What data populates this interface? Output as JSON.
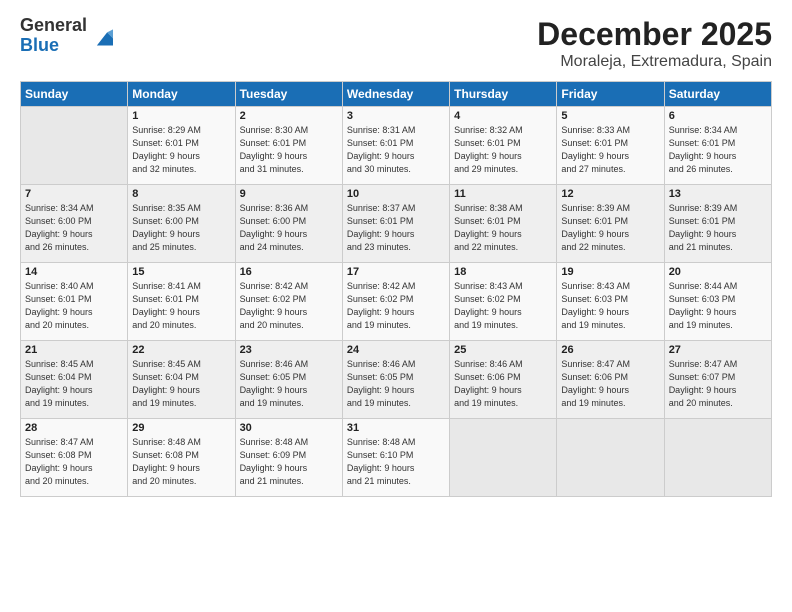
{
  "logo": {
    "general": "General",
    "blue": "Blue"
  },
  "title": "December 2025",
  "location": "Moraleja, Extremadura, Spain",
  "weekdays": [
    "Sunday",
    "Monday",
    "Tuesday",
    "Wednesday",
    "Thursday",
    "Friday",
    "Saturday"
  ],
  "weeks": [
    [
      {
        "day": "",
        "info": ""
      },
      {
        "day": "1",
        "info": "Sunrise: 8:29 AM\nSunset: 6:01 PM\nDaylight: 9 hours\nand 32 minutes."
      },
      {
        "day": "2",
        "info": "Sunrise: 8:30 AM\nSunset: 6:01 PM\nDaylight: 9 hours\nand 31 minutes."
      },
      {
        "day": "3",
        "info": "Sunrise: 8:31 AM\nSunset: 6:01 PM\nDaylight: 9 hours\nand 30 minutes."
      },
      {
        "day": "4",
        "info": "Sunrise: 8:32 AM\nSunset: 6:01 PM\nDaylight: 9 hours\nand 29 minutes."
      },
      {
        "day": "5",
        "info": "Sunrise: 8:33 AM\nSunset: 6:01 PM\nDaylight: 9 hours\nand 27 minutes."
      },
      {
        "day": "6",
        "info": "Sunrise: 8:34 AM\nSunset: 6:01 PM\nDaylight: 9 hours\nand 26 minutes."
      }
    ],
    [
      {
        "day": "7",
        "info": "Sunrise: 8:34 AM\nSunset: 6:00 PM\nDaylight: 9 hours\nand 26 minutes."
      },
      {
        "day": "8",
        "info": "Sunrise: 8:35 AM\nSunset: 6:00 PM\nDaylight: 9 hours\nand 25 minutes."
      },
      {
        "day": "9",
        "info": "Sunrise: 8:36 AM\nSunset: 6:00 PM\nDaylight: 9 hours\nand 24 minutes."
      },
      {
        "day": "10",
        "info": "Sunrise: 8:37 AM\nSunset: 6:01 PM\nDaylight: 9 hours\nand 23 minutes."
      },
      {
        "day": "11",
        "info": "Sunrise: 8:38 AM\nSunset: 6:01 PM\nDaylight: 9 hours\nand 22 minutes."
      },
      {
        "day": "12",
        "info": "Sunrise: 8:39 AM\nSunset: 6:01 PM\nDaylight: 9 hours\nand 22 minutes."
      },
      {
        "day": "13",
        "info": "Sunrise: 8:39 AM\nSunset: 6:01 PM\nDaylight: 9 hours\nand 21 minutes."
      }
    ],
    [
      {
        "day": "14",
        "info": "Sunrise: 8:40 AM\nSunset: 6:01 PM\nDaylight: 9 hours\nand 20 minutes."
      },
      {
        "day": "15",
        "info": "Sunrise: 8:41 AM\nSunset: 6:01 PM\nDaylight: 9 hours\nand 20 minutes."
      },
      {
        "day": "16",
        "info": "Sunrise: 8:42 AM\nSunset: 6:02 PM\nDaylight: 9 hours\nand 20 minutes."
      },
      {
        "day": "17",
        "info": "Sunrise: 8:42 AM\nSunset: 6:02 PM\nDaylight: 9 hours\nand 19 minutes."
      },
      {
        "day": "18",
        "info": "Sunrise: 8:43 AM\nSunset: 6:02 PM\nDaylight: 9 hours\nand 19 minutes."
      },
      {
        "day": "19",
        "info": "Sunrise: 8:43 AM\nSunset: 6:03 PM\nDaylight: 9 hours\nand 19 minutes."
      },
      {
        "day": "20",
        "info": "Sunrise: 8:44 AM\nSunset: 6:03 PM\nDaylight: 9 hours\nand 19 minutes."
      }
    ],
    [
      {
        "day": "21",
        "info": "Sunrise: 8:45 AM\nSunset: 6:04 PM\nDaylight: 9 hours\nand 19 minutes."
      },
      {
        "day": "22",
        "info": "Sunrise: 8:45 AM\nSunset: 6:04 PM\nDaylight: 9 hours\nand 19 minutes."
      },
      {
        "day": "23",
        "info": "Sunrise: 8:46 AM\nSunset: 6:05 PM\nDaylight: 9 hours\nand 19 minutes."
      },
      {
        "day": "24",
        "info": "Sunrise: 8:46 AM\nSunset: 6:05 PM\nDaylight: 9 hours\nand 19 minutes."
      },
      {
        "day": "25",
        "info": "Sunrise: 8:46 AM\nSunset: 6:06 PM\nDaylight: 9 hours\nand 19 minutes."
      },
      {
        "day": "26",
        "info": "Sunrise: 8:47 AM\nSunset: 6:06 PM\nDaylight: 9 hours\nand 19 minutes."
      },
      {
        "day": "27",
        "info": "Sunrise: 8:47 AM\nSunset: 6:07 PM\nDaylight: 9 hours\nand 20 minutes."
      }
    ],
    [
      {
        "day": "28",
        "info": "Sunrise: 8:47 AM\nSunset: 6:08 PM\nDaylight: 9 hours\nand 20 minutes."
      },
      {
        "day": "29",
        "info": "Sunrise: 8:48 AM\nSunset: 6:08 PM\nDaylight: 9 hours\nand 20 minutes."
      },
      {
        "day": "30",
        "info": "Sunrise: 8:48 AM\nSunset: 6:09 PM\nDaylight: 9 hours\nand 21 minutes."
      },
      {
        "day": "31",
        "info": "Sunrise: 8:48 AM\nSunset: 6:10 PM\nDaylight: 9 hours\nand 21 minutes."
      },
      {
        "day": "",
        "info": ""
      },
      {
        "day": "",
        "info": ""
      },
      {
        "day": "",
        "info": ""
      }
    ]
  ]
}
